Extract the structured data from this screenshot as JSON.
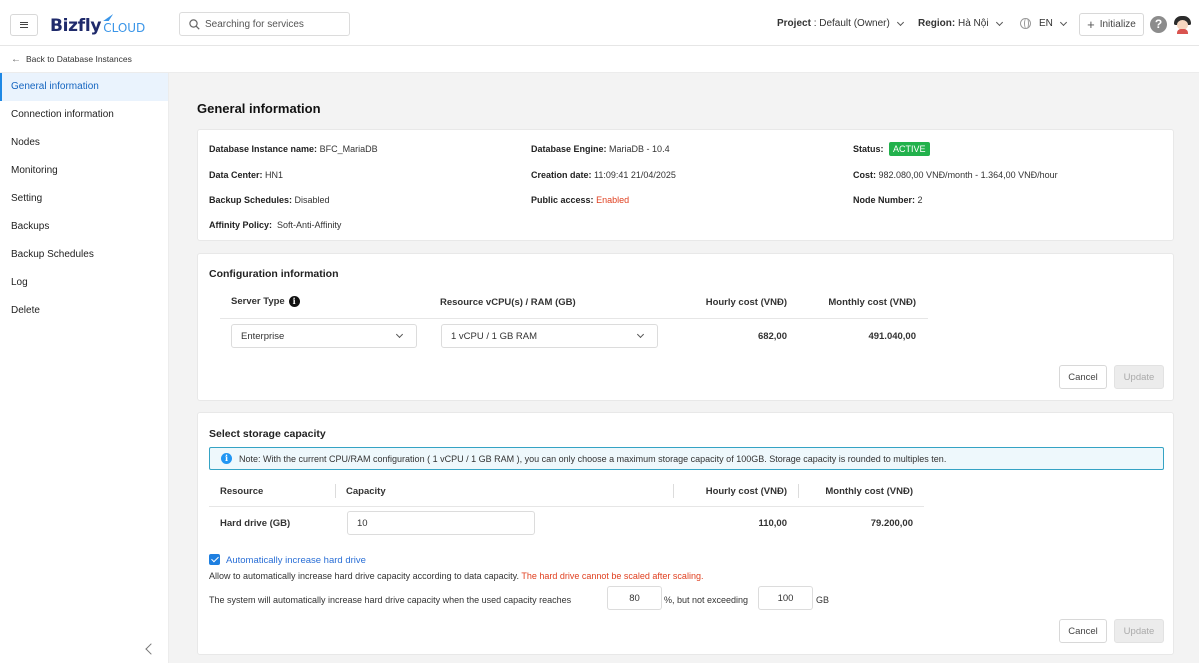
{
  "header": {
    "logo_main": "Bizfly",
    "logo_sub": "CLOUD",
    "search_placeholder": "Searching for services",
    "project_label": "Project",
    "project_value": ": Default (Owner)",
    "region_label": "Region:",
    "region_value": "Hà Nội",
    "language": "EN",
    "initialize_label": "Initialize",
    "help_symbol": "?"
  },
  "breadcrumb": {
    "back_label": "Back to Database Instances"
  },
  "sidebar": {
    "items": [
      {
        "label": "General information"
      },
      {
        "label": "Connection information"
      },
      {
        "label": "Nodes"
      },
      {
        "label": "Monitoring"
      },
      {
        "label": "Setting"
      },
      {
        "label": "Backups"
      },
      {
        "label": "Backup Schedules"
      },
      {
        "label": "Log"
      },
      {
        "label": "Delete"
      }
    ]
  },
  "general": {
    "title": "General information",
    "instance_name_label": "Database Instance name:",
    "instance_name": "BFC_MariaDB",
    "engine_label": "Database Engine:",
    "engine": "MariaDB - 10.4",
    "status_label": "Status:",
    "status": "ACTIVE",
    "datacenter_label": "Data Center:",
    "datacenter": "HN1",
    "creation_label": "Creation date:",
    "creation": "11:09:41 21/04/2025",
    "cost_label": "Cost:",
    "cost": "982.080,00 VNĐ/month - 1.364,00 VNĐ/hour",
    "backup_label": "Backup Schedules:",
    "backup": "Disabled",
    "public_label": "Public access:",
    "public": "Enabled",
    "node_number_label": "Node Number:",
    "node_number": "2",
    "affinity_label": "Affinity Policy:",
    "affinity": "Soft-Anti-Affinity"
  },
  "config": {
    "title": "Configuration information",
    "col_server_type": "Server Type",
    "col_resource": "Resource vCPU(s) / RAM (GB)",
    "col_hourly": "Hourly cost (VNĐ)",
    "col_monthly": "Monthly cost (VNĐ)",
    "server_type": "Enterprise",
    "resource": "1 vCPU / 1 GB RAM",
    "hourly": "682,00",
    "monthly": "491.040,00",
    "cancel_label": "Cancel",
    "update_label": "Update"
  },
  "storage": {
    "title": "Select storage capacity",
    "note": "Note: With the current CPU/RAM configuration ( 1 vCPU / 1 GB RAM ), you can only choose a maximum storage capacity of 100GB. Storage capacity is rounded to multiples ten.",
    "col_resource": "Resource",
    "col_capacity": "Capacity",
    "col_hourly": "Hourly cost (VNĐ)",
    "col_monthly": "Monthly cost (VNĐ)",
    "row_label": "Hard drive (GB)",
    "capacity": "10",
    "hourly": "110,00",
    "monthly": "79.200,00",
    "auto_increase_label": "Automatically increase hard drive",
    "auto_desc": "Allow to automatically increase hard drive capacity according to data capacity.",
    "auto_warning": "The hard drive cannot be scaled after scaling.",
    "threshold_prefix": "The system will automatically increase hard drive capacity when the used capacity reaches",
    "threshold_value": "80",
    "threshold_middle": "%, but not exceeding",
    "max_value": "100",
    "max_unit": "GB",
    "cancel_label": "Cancel",
    "update_label": "Update"
  }
}
